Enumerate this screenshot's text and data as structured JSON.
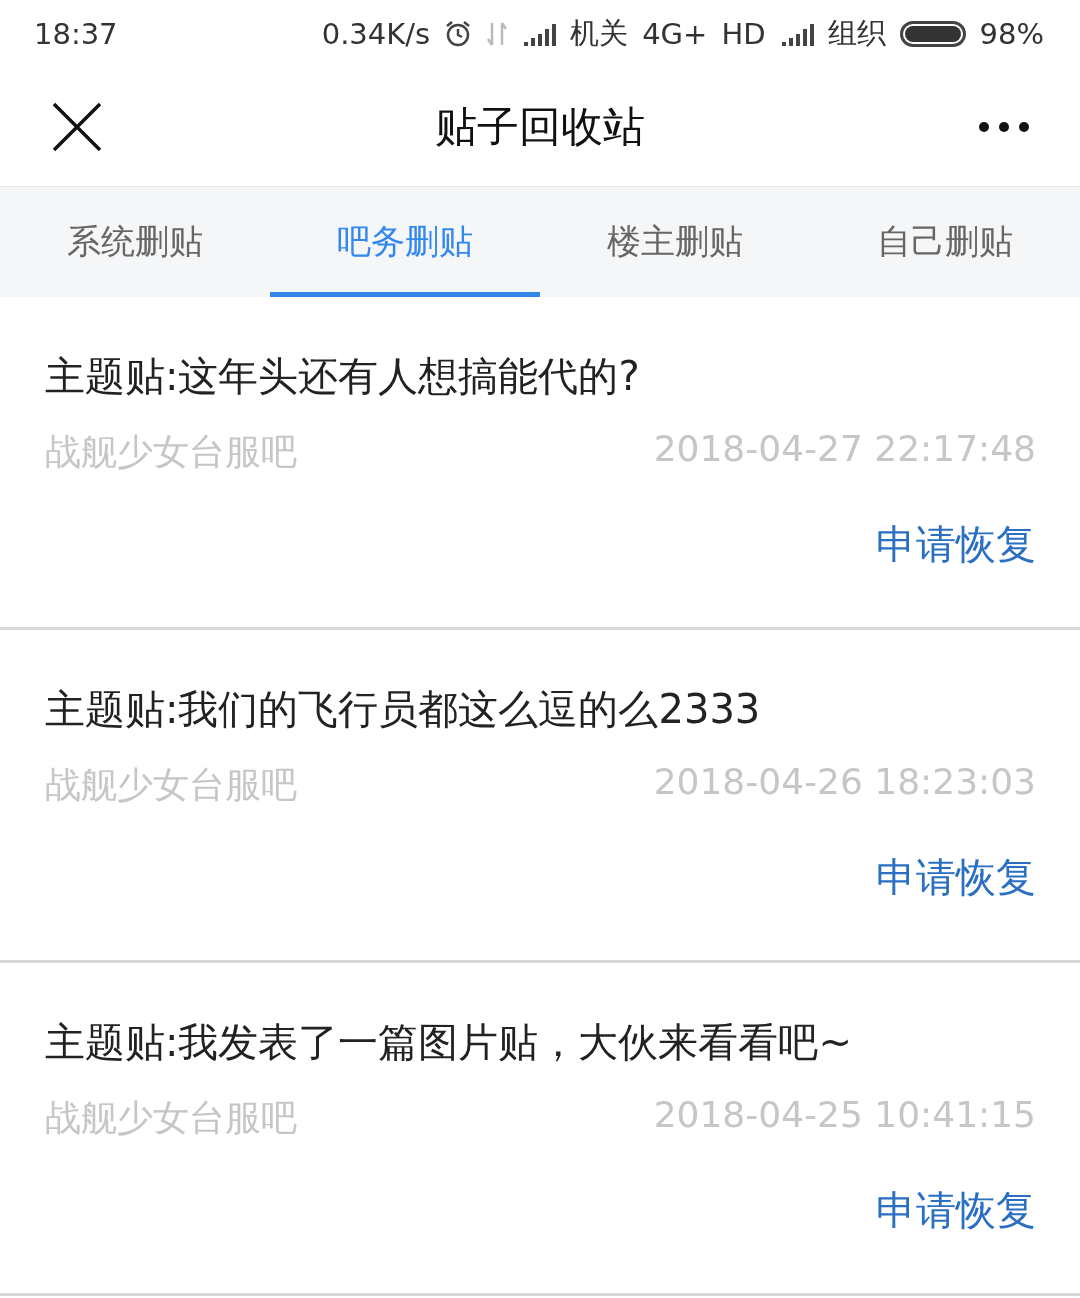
{
  "status_bar": {
    "time": "18:37",
    "speed": "0.34K/s",
    "carrier_1": "机关",
    "network": "4G+",
    "hd": "HD",
    "carrier_2": "组织",
    "battery": "98%"
  },
  "header": {
    "title": "贴子回收站"
  },
  "tabs": [
    {
      "label": "系统删贴",
      "selected": false
    },
    {
      "label": "吧务删贴",
      "selected": true
    },
    {
      "label": "楼主删贴",
      "selected": false
    },
    {
      "label": "自己删贴",
      "selected": false
    }
  ],
  "posts": [
    {
      "title": "主题贴:这年头还有人想搞能代的?",
      "forum": "战舰少女台服吧",
      "time": "2018-04-27 22:17:48",
      "action": "申请恢复"
    },
    {
      "title": "主题贴:我们的飞行员都这么逗的么2333",
      "forum": "战舰少女台服吧",
      "time": "2018-04-26 18:23:03",
      "action": "申请恢复"
    },
    {
      "title": "主题贴:我发表了一篇图片贴，大伙来看看吧~",
      "forum": "战舰少女台服吧",
      "time": "2018-04-25 10:41:15",
      "action": "申请恢复"
    }
  ]
}
